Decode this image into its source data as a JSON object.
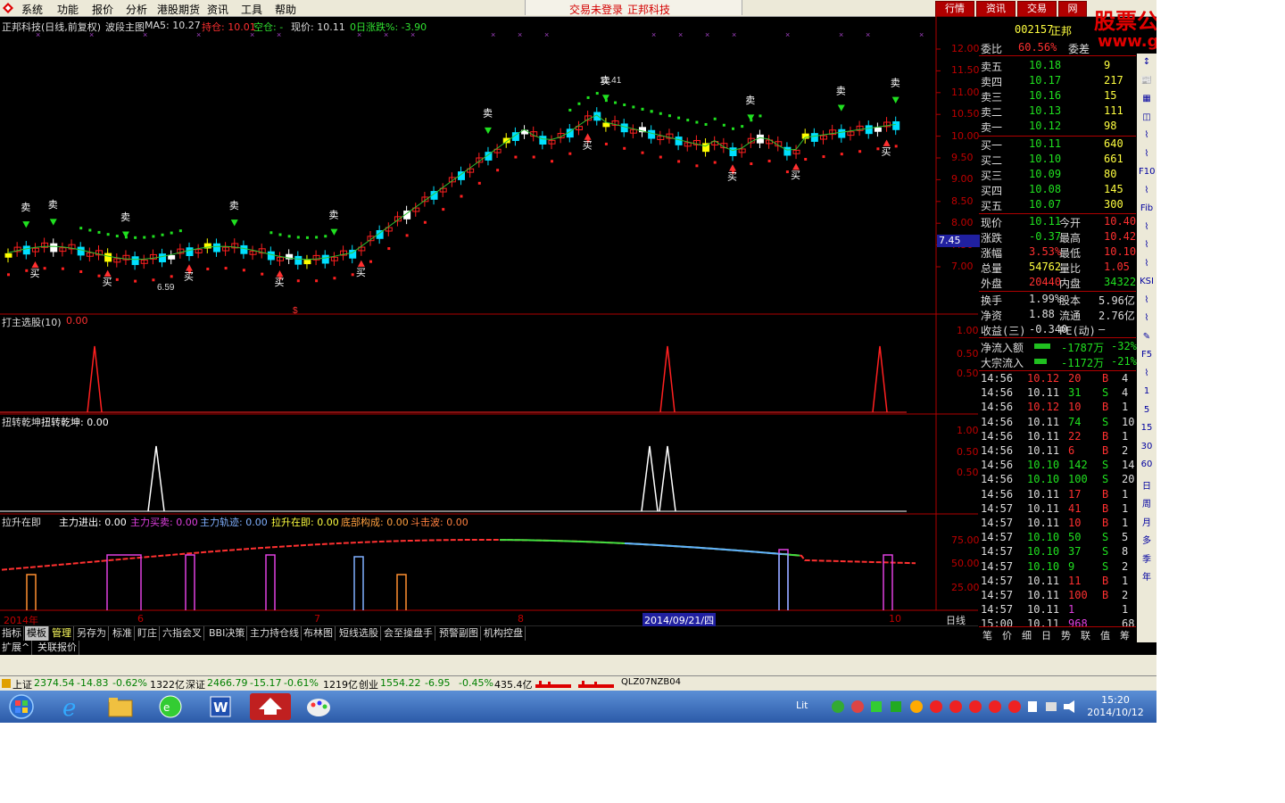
{
  "menubar": {
    "items": [
      "系统",
      "功能",
      "报价",
      "分析",
      "港股期货",
      "资讯",
      "工具",
      "帮助"
    ],
    "login_status": "交易未登录",
    "vendor": "正邦科技",
    "right_buttons": [
      "行情",
      "资讯",
      "交易",
      "网"
    ]
  },
  "watermark": {
    "title": "股票公式在线网",
    "url": "www.gsxx.com.cn"
  },
  "main_header": {
    "title": "正邦科技(日线,前复权)",
    "indicator": "波段主图",
    "ma5": "MA5: 10.27",
    "hold": "持仓: 10.01",
    "empty": "空仓: -",
    "price": "现价: 10.11",
    "pct": "0日涨跌%: -3.90"
  },
  "price_axis": [
    "12.00",
    "11.50",
    "11.00",
    "10.50",
    "10.00",
    "9.50",
    "9.00",
    "8.50",
    "8.00",
    "7.50",
    "7.00"
  ],
  "price_marker": "7.45",
  "signals": {
    "buy": "买",
    "sell": "卖",
    "low_label": "6.59",
    "high_label": "11.41"
  },
  "panels": [
    {
      "title": "打主选股(10)",
      "value": "0.00",
      "axis": [
        "1.00",
        "0.50",
        "0.50"
      ]
    },
    {
      "title": "扭转乾坤",
      "subtitle": "扭转乾坤: 0.00",
      "axis": [
        "1.00",
        "0.50",
        "0.50"
      ]
    },
    {
      "title": "拉升在即",
      "legend": [
        "主力进出: 0.00",
        "主力买卖: 0.00",
        "主力轨迹: 0.00",
        "拉升在即: 0.00",
        "底部构成: 0.00",
        "斗击波: 0.00"
      ],
      "axis": [
        "75.00",
        "50.00",
        "25.00"
      ]
    }
  ],
  "date_axis": {
    "labels": [
      "2014年",
      "6",
      "7",
      "8",
      "2014/09/21/四",
      "10"
    ],
    "period": "日线"
  },
  "tabs": [
    "指标",
    "模板",
    "管理",
    "另存为",
    "标准",
    "盯庄",
    "六指会叉",
    "BBI决策",
    "主力持仓线",
    "布林图",
    "短线选股",
    "会至操盘手",
    "预警副图",
    "机构控盘"
  ],
  "extension": [
    "扩展^",
    "关联报价"
  ],
  "quote": {
    "code": "002157",
    "name": "正邦",
    "weibi_label": "委比",
    "weibi": "60.56%",
    "weicha_label": "委差",
    "asks": [
      {
        "label": "卖五",
        "price": "10.18",
        "vol": "9"
      },
      {
        "label": "卖四",
        "price": "10.17",
        "vol": "217"
      },
      {
        "label": "卖三",
        "price": "10.16",
        "vol": "15"
      },
      {
        "label": "卖二",
        "price": "10.13",
        "vol": "111"
      },
      {
        "label": "卖一",
        "price": "10.12",
        "vol": "98"
      }
    ],
    "bids": [
      {
        "label": "买一",
        "price": "10.11",
        "vol": "640"
      },
      {
        "label": "买二",
        "price": "10.10",
        "vol": "661"
      },
      {
        "label": "买三",
        "price": "10.09",
        "vol": "80"
      },
      {
        "label": "买四",
        "price": "10.08",
        "vol": "145"
      },
      {
        "label": "买五",
        "price": "10.07",
        "vol": "300"
      }
    ],
    "stats": [
      {
        "l1": "现价",
        "v1": "10.11",
        "l2": "今开",
        "v2": "10.40"
      },
      {
        "l1": "涨跌",
        "v1": "-0.37",
        "l2": "最高",
        "v2": "10.42"
      },
      {
        "l1": "涨幅",
        "v1": "3.53%",
        "l2": "最低",
        "v2": "10.10"
      },
      {
        "l1": "总量",
        "v1": "54762",
        "l2": "量比",
        "v2": "1.05"
      },
      {
        "l1": "外盘",
        "v1": "20440",
        "l2": "内盘",
        "v2": "34322"
      }
    ],
    "stats2": [
      {
        "l1": "换手",
        "v1": "1.99%",
        "l2": "股本",
        "v2": "5.96亿"
      },
      {
        "l1": "净资",
        "v1": "1.88",
        "l2": "流通",
        "v2": "2.76亿"
      },
      {
        "l1": "收益(三)",
        "v1": "-0.340",
        "l2": "PE(动)",
        "v2": "—"
      }
    ],
    "flows": [
      {
        "label": "净流入额",
        "v": "-1787万",
        "p": "-32%"
      },
      {
        "label": "大宗流入",
        "v": "-1172万",
        "p": "-21%"
      }
    ],
    "ticks": [
      {
        "t": "14:56",
        "p": "10.12",
        "v": "20",
        "d": "B",
        "n": "4"
      },
      {
        "t": "14:56",
        "p": "10.11",
        "v": "31",
        "d": "S",
        "n": "4"
      },
      {
        "t": "14:56",
        "p": "10.12",
        "v": "10",
        "d": "B",
        "n": "1"
      },
      {
        "t": "14:56",
        "p": "10.11",
        "v": "74",
        "d": "S",
        "n": "10"
      },
      {
        "t": "14:56",
        "p": "10.11",
        "v": "22",
        "d": "B",
        "n": "1"
      },
      {
        "t": "14:56",
        "p": "10.11",
        "v": "6",
        "d": "B",
        "n": "2"
      },
      {
        "t": "14:56",
        "p": "10.10",
        "v": "142",
        "d": "S",
        "n": "14"
      },
      {
        "t": "14:56",
        "p": "10.10",
        "v": "100",
        "d": "S",
        "n": "20"
      },
      {
        "t": "14:56",
        "p": "10.11",
        "v": "17",
        "d": "B",
        "n": "1"
      },
      {
        "t": "14:57",
        "p": "10.11",
        "v": "41",
        "d": "B",
        "n": "1"
      },
      {
        "t": "14:57",
        "p": "10.11",
        "v": "10",
        "d": "B",
        "n": "1"
      },
      {
        "t": "14:57",
        "p": "10.10",
        "v": "50",
        "d": "S",
        "n": "5"
      },
      {
        "t": "14:57",
        "p": "10.10",
        "v": "37",
        "d": "S",
        "n": "8"
      },
      {
        "t": "14:57",
        "p": "10.10",
        "v": "9",
        "d": "S",
        "n": "2"
      },
      {
        "t": "14:57",
        "p": "10.11",
        "v": "11",
        "d": "B",
        "n": "1"
      },
      {
        "t": "14:57",
        "p": "10.11",
        "v": "100",
        "d": "B",
        "n": "2"
      },
      {
        "t": "14:57",
        "p": "10.11",
        "v": "1",
        "d": "",
        "n": "1"
      },
      {
        "t": "15:00",
        "p": "10.11",
        "v": "968",
        "d": "",
        "n": "68"
      }
    ],
    "bottom_tabs": [
      "笔",
      "价",
      "细",
      "日",
      "势",
      "联",
      "值",
      "筹"
    ]
  },
  "side_tools": [
    "↕",
    "📰",
    "▦",
    "◫",
    "⌇",
    "⌇",
    "F10",
    "⌇",
    "Fib",
    "⌇",
    "⌇",
    "⌇",
    "KSI",
    "⌇",
    "⌇",
    "✎",
    "F5",
    "⌇",
    "1",
    "5",
    "15",
    "30",
    "60",
    "日",
    "周",
    "月",
    "多",
    "季",
    "年"
  ],
  "index_bar": [
    {
      "name": "上证",
      "val": "2374.54",
      "chg": "-14.83",
      "pct": "-0.62%",
      "amt": "1322亿"
    },
    {
      "name": "深证",
      "val": "2466.79",
      "chg": "-15.17",
      "pct": "-0.61%",
      "amt": "1219亿"
    },
    {
      "name": "创业",
      "val": "1554.22",
      "chg": "-6.95",
      "pct": "-0.45%",
      "amt": "435.4亿"
    }
  ],
  "index_code": "QLZ07NZB04",
  "clock": {
    "time": "15:20",
    "date": "2014/10/12"
  },
  "tray_lang": "Lit"
}
